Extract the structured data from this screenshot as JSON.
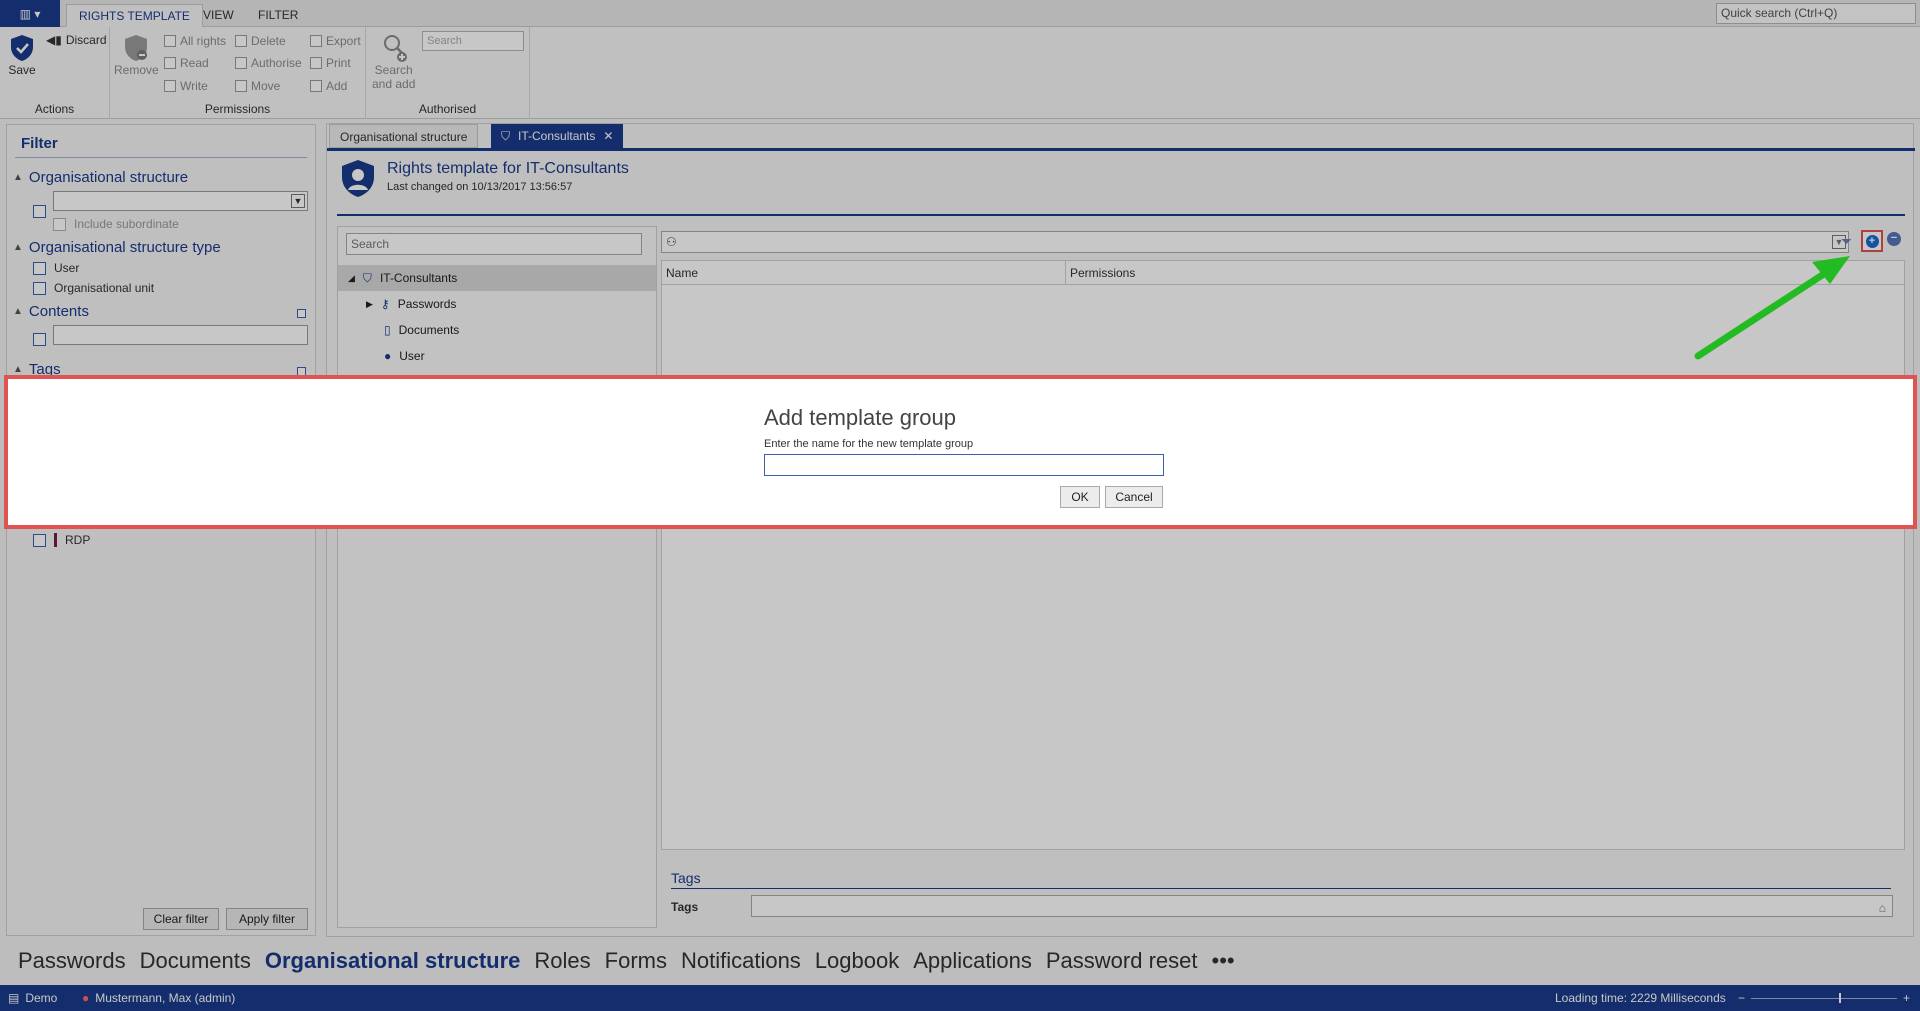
{
  "ribbon": {
    "tabs": [
      "RIGHTS TEMPLATE",
      "VIEW",
      "FILTER"
    ],
    "quick_search": "Quick search (Ctrl+Q)",
    "actions": {
      "save": "Save",
      "discard": "Discard",
      "label": "Actions"
    },
    "permissions": {
      "remove": "Remove",
      "checks": [
        "All rights",
        "Read",
        "Write",
        "Delete",
        "Authorise",
        "Move",
        "Export",
        "Print",
        "Add"
      ],
      "label": "Permissions"
    },
    "authorised": {
      "search_placeholder": "Search",
      "search_and_add_1": "Search",
      "search_and_add_2": "and add",
      "label": "Authorised"
    }
  },
  "filter": {
    "title": "Filter",
    "sections": {
      "org_structure": "Organisational structure",
      "include_subordinate": "Include subordinate",
      "org_structure_type": "Organisational structure type",
      "user": "User",
      "org_unit": "Organisational unit",
      "contents": "Contents",
      "tags": "Tags",
      "rdp": "RDP"
    },
    "clear": "Clear filter",
    "apply": "Apply filter"
  },
  "main": {
    "tabs": [
      "Organisational structure",
      "IT-Consultants"
    ],
    "title": "Rights template for IT-Consultants",
    "last_changed": "Last changed on 10/13/2017 13:56:57",
    "search_placeholder": "Search",
    "tree": [
      "IT-Consultants",
      "Passwords",
      "Documents",
      "User"
    ],
    "grid_columns": [
      "Name",
      "Permissions"
    ],
    "tags_section": "Tags",
    "tags_label": "Tags"
  },
  "bottom_nav": [
    "Passwords",
    "Documents",
    "Organisational structure",
    "Roles",
    "Forms",
    "Notifications",
    "Logbook",
    "Applications",
    "Password reset",
    "•••"
  ],
  "statusbar": {
    "db": "Demo",
    "user": "Mustermann, Max (admin)",
    "loading": "Loading time: 2229 Milliseconds"
  },
  "dialog": {
    "title": "Add template group",
    "prompt": "Enter the name for the new template group",
    "value": "",
    "ok": "OK",
    "cancel": "Cancel"
  },
  "colors": {
    "accent": "#1a3a8c",
    "highlight": "#e05353",
    "arrow": "#22bb22"
  }
}
